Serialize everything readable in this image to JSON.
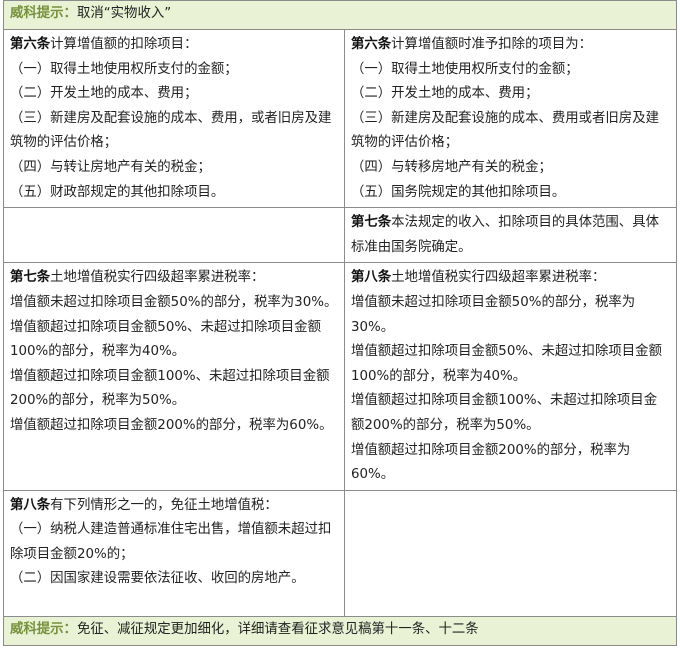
{
  "tip_top": {
    "label": "威科提示：",
    "text": "取消“实物收入”"
  },
  "rows": [
    {
      "left": {
        "article": "第六条",
        "heading": "计算增值额的扣除项目：",
        "lines": [
          "（一）取得土地使用权所支付的金额；",
          "（二）开发土地的成本、费用；",
          "（三）新建房及配套设施的成本、费用，或者旧房及建筑物的评估价格；",
          "（四）与转让房地产有关的税金；",
          "（五）财政部规定的其他扣除项目。"
        ]
      },
      "right": {
        "article": "第六条",
        "heading": "计算增值额时准予扣除的项目为：",
        "lines": [
          "（一）取得土地使用权所支付的金额；",
          "（二）开发土地的成本、费用；",
          "（三）新建房及配套设施的成本、费用或者旧房及建筑物的评估价格；",
          "（四）与转移房地产有关的税金；",
          "（五）国务院规定的其他扣除项目。"
        ]
      }
    },
    {
      "left": null,
      "right": {
        "article": "第七条",
        "heading": "本法规定的收入、扣除项目的具体范围、具体标准由国务院确定。",
        "lines": []
      }
    },
    {
      "left": {
        "article": "第七条",
        "heading": "土地增值税实行四级超率累进税率：",
        "lines": [
          "增值额未超过扣除项目金额50%的部分，税率为30%。",
          "增值额超过扣除项目金额50%、未超过扣除项目金额100%的部分，税率为40%。",
          "增值额超过扣除项目金额100%、未超过扣除项目金额200%的部分，税率为50%。",
          "增值额超过扣除项目金额200%的部分，税率为60%。"
        ]
      },
      "right": {
        "article": "第八条",
        "heading": "土地增值税实行四级超率累进税率：",
        "lines": [
          "增值额未超过扣除项目金额50%的部分，税率为30%。",
          "增值额超过扣除项目金额50%、未超过扣除项目金额100%的部分，税率为40%。",
          "增值额超过扣除项目金额100%、未超过扣除项目金额200%的部分，税率为50%。",
          "增值额超过扣除项目金额200%的部分，税率为60%。"
        ]
      }
    },
    {
      "left": {
        "article": "第八条",
        "heading": "有下列情形之一的，免征土地增值税：",
        "lines": [
          "（一）纳税人建造普通标准住宅出售，增值额未超过扣除项目金额20%的；",
          "（二）因国家建设需要依法征收、收回的房地产。"
        ]
      },
      "right": null
    }
  ],
  "tip_bottom": {
    "label": "威科提示：",
    "text": "免征、减征规定更加细化，详细请查看征求意见稿第十一条、十二条"
  }
}
